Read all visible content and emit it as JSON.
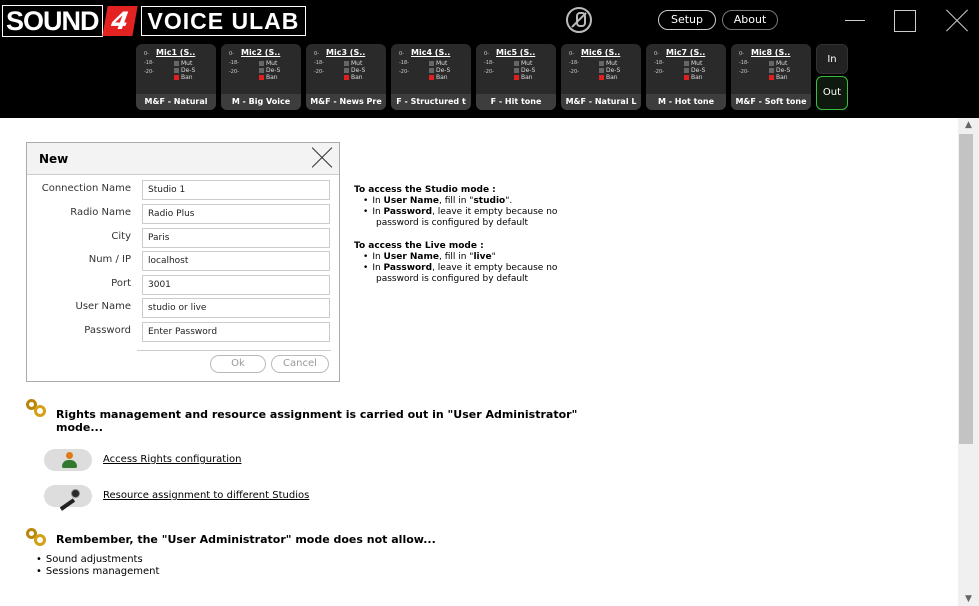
{
  "app": {
    "logo_left": "SOUND",
    "logo_num": "4",
    "logo_right": "VOICE ULAB",
    "setup_label": "Setup",
    "about_label": "About"
  },
  "mics": [
    {
      "title": "Mic1 (S..",
      "preset": "M&F - Natural"
    },
    {
      "title": "Mic2 (S..",
      "preset": "M - Big Voice"
    },
    {
      "title": "Mic3 (S..",
      "preset": "M&F - News Pre"
    },
    {
      "title": "Mic4 (S..",
      "preset": "F - Structured t"
    },
    {
      "title": "Mic5 (S..",
      "preset": "F - Hit tone"
    },
    {
      "title": "Mic6 (S..",
      "preset": "M&F - Natural L"
    },
    {
      "title": "Mic7 (S..",
      "preset": "M - Hot tone"
    },
    {
      "title": "Mic8 (S..",
      "preset": "M&F - Soft tone"
    }
  ],
  "mic_controls": {
    "mute": "Mut",
    "deess": "De-S",
    "ban": "Ban",
    "scale": [
      "0-",
      "-18-",
      "-20-"
    ]
  },
  "io": {
    "in_label": "In",
    "out_label": "Out"
  },
  "dialog": {
    "title": "New",
    "fields": [
      {
        "label": "Connection Name",
        "value": "Studio 1"
      },
      {
        "label": "Radio Name",
        "value": "Radio Plus"
      },
      {
        "label": "City",
        "value": "Paris"
      },
      {
        "label": "Num / IP",
        "value": "localhost"
      },
      {
        "label": "Port",
        "value": "3001"
      },
      {
        "label": "User Name",
        "value": "studio or live"
      },
      {
        "label": "Password",
        "value": "Enter Password"
      }
    ],
    "ok_label": "Ok",
    "cancel_label": "Cancel"
  },
  "help": {
    "studio_title": "To access the Studio mode :",
    "studio_user_pre": "In ",
    "studio_user_bold": "User Name",
    "studio_user_post": ", fill in \"",
    "studio_user_value": "studio",
    "studio_user_end": "\".",
    "studio_pass_pre": "In ",
    "studio_pass_bold": "Password",
    "studio_pass_post": ", leave it empty because no",
    "studio_pass_line2": "password is configured by default",
    "live_title": "To access the Live mode :",
    "live_user_pre": "In ",
    "live_user_bold": "User Name",
    "live_user_post": ", fill in \"",
    "live_user_value": "live",
    "live_user_end": "\"",
    "live_pass_pre": "In ",
    "live_pass_bold": "Password",
    "live_pass_post": ", leave it empty because no",
    "live_pass_line2": "password is configured by default"
  },
  "rights": {
    "title_line1": "Rights management and resource assignment is carried out in  \"User Administrator\"",
    "title_line2": "mode...",
    "access_link": "Access Rights configuration",
    "resource_link": "Resource assignment to different Studios"
  },
  "remember": {
    "title": "Rembember, the \"User Administrator\" mode does not allow...",
    "items": [
      "Sound adjustments",
      "Sessions management"
    ]
  }
}
